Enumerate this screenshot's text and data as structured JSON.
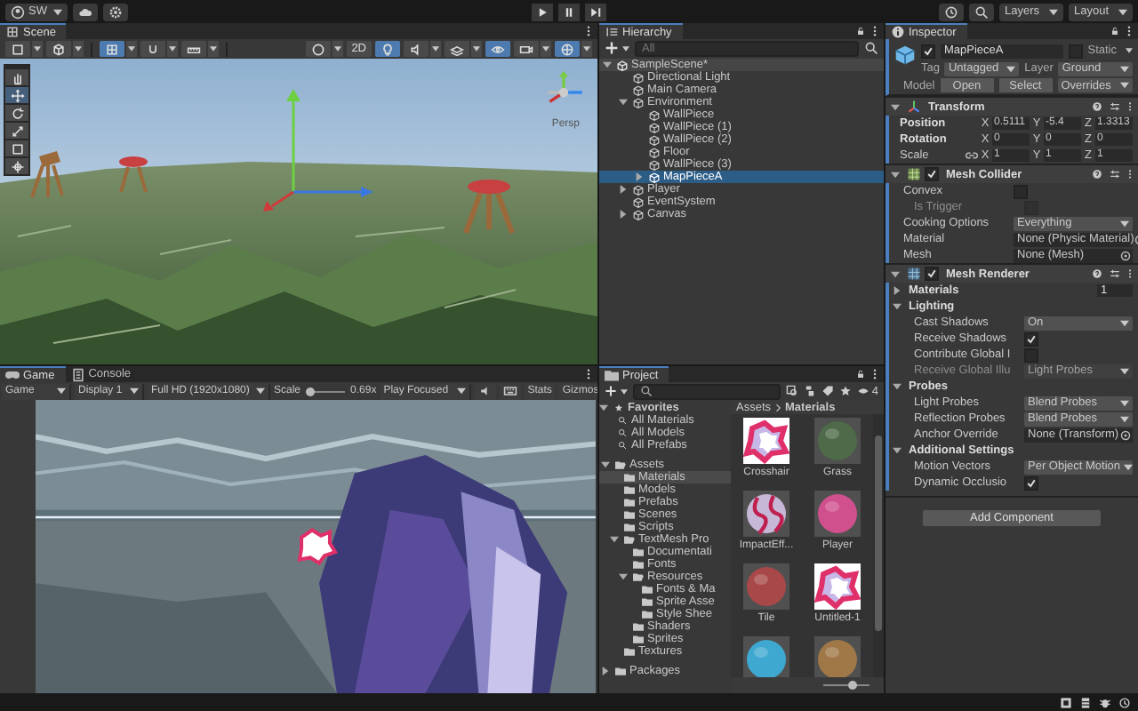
{
  "toolbar": {
    "account": "SW",
    "layers": "Layers",
    "layout": "Layout"
  },
  "scene": {
    "tab": "Scene",
    "toolbar": [
      {
        "kind": "shading",
        "selected": false
      },
      {
        "kind": "render",
        "selected": false
      },
      {
        "kind": "grid",
        "selected": true
      },
      {
        "kind": "snap",
        "selected": false
      },
      {
        "kind": "increment",
        "selected": false
      },
      {
        "kind": "orbit",
        "selected": false
      },
      {
        "kind": "dimension",
        "selected": false
      },
      {
        "kind": "light",
        "selected": true
      },
      {
        "kind": "audio",
        "selected": false
      },
      {
        "kind": "effects",
        "selected": false
      },
      {
        "kind": "visibility",
        "selected": true
      },
      {
        "kind": "camera",
        "selected": false
      },
      {
        "kind": "gizmos",
        "selected": true
      }
    ],
    "toggle_2d": "2D",
    "tools": [
      {
        "kind": "hand",
        "selected": false
      },
      {
        "kind": "move",
        "selected": true
      },
      {
        "kind": "rotate",
        "selected": false
      },
      {
        "kind": "scale",
        "selected": false
      },
      {
        "kind": "rect",
        "selected": false
      },
      {
        "kind": "transform",
        "selected": false
      }
    ],
    "view_label": "Persp"
  },
  "game": {
    "tabs": [
      {
        "label": "Game",
        "selected": true
      },
      {
        "label": "Console",
        "selected": false
      }
    ],
    "view_mode": "Game",
    "display": "Display 1",
    "resolution": "Full HD (1920x1080)",
    "scale_label": "Scale",
    "scale": {
      "level": 0.1
    },
    "scale_value": "0.69x",
    "play_mode": "Play Focused",
    "stats": "Stats",
    "gizmos": "Gizmos"
  },
  "hierarchy": {
    "title": "Hierarchy",
    "search_placeholder": "All",
    "tree": [
      {
        "name": "SampleScene*",
        "kind": "scene",
        "expanded": true,
        "selected": false,
        "children": [
          {
            "name": "Directional Light",
            "kind": "object",
            "selected": false
          },
          {
            "name": "Main Camera",
            "kind": "object",
            "selected": false
          },
          {
            "name": "Environment",
            "kind": "object",
            "expanded": true,
            "selected": false,
            "children": [
              {
                "name": "WallPiece",
                "kind": "object",
                "selected": false
              },
              {
                "name": "WallPiece (1)",
                "kind": "object",
                "selected": false
              },
              {
                "name": "WallPiece (2)",
                "kind": "object",
                "selected": false
              },
              {
                "name": "Floor",
                "kind": "object",
                "selected": false
              },
              {
                "name": "WallPiece (3)",
                "kind": "object",
                "selected": false
              },
              {
                "name": "MapPieceA",
                "kind": "object",
                "expanded": false,
                "selected": true
              }
            ]
          },
          {
            "name": "Player",
            "kind": "object",
            "expanded": false,
            "selected": false
          },
          {
            "name": "EventSystem",
            "kind": "object",
            "selected": false
          },
          {
            "name": "Canvas",
            "kind": "object",
            "expanded": false,
            "selected": false
          }
        ]
      }
    ]
  },
  "project": {
    "title": "Project",
    "item_count": "4",
    "favorites": {
      "label": "Favorites",
      "expanded": true,
      "items": [
        "All Materials",
        "All Models",
        "All Prefabs"
      ]
    },
    "assets_tree": [
      {
        "name": "Assets",
        "expanded": true,
        "selected": false,
        "children": [
          {
            "name": "Materials",
            "selected": true
          },
          {
            "name": "Models",
            "selected": false
          },
          {
            "name": "Prefabs",
            "selected": false
          },
          {
            "name": "Scenes",
            "selected": false
          },
          {
            "name": "Scripts",
            "selected": false
          },
          {
            "name": "TextMesh Pro",
            "expanded": true,
            "selected": false,
            "children": [
              {
                "name": "Documentati",
                "selected": false
              },
              {
                "name": "Fonts",
                "selected": false
              },
              {
                "name": "Resources",
                "expanded": true,
                "selected": false,
                "children": [
                  {
                    "name": "Fonts & Ma",
                    "selected": false
                  },
                  {
                    "name": "Sprite Asse",
                    "selected": false
                  },
                  {
                    "name": "Style Shee",
                    "selected": false
                  }
                ]
              },
              {
                "name": "Shaders",
                "selected": false
              },
              {
                "name": "Sprites",
                "selected": false
              }
            ]
          },
          {
            "name": "Textures",
            "selected": false
          }
        ]
      },
      {
        "name": "Packages",
        "expanded": false,
        "selected": false
      }
    ],
    "breadcrumb": [
      "Assets",
      "Materials"
    ],
    "assets": [
      {
        "name": "Crosshair",
        "kind": "image",
        "color": "#e0306a"
      },
      {
        "name": "Grass",
        "kind": "sphere",
        "color": "#4e6a48"
      },
      {
        "name": "ImpactEff...",
        "kind": "striped",
        "color": "#c8b8d8"
      },
      {
        "name": "Player",
        "kind": "sphere",
        "color": "#d0508e"
      },
      {
        "name": "Tile",
        "kind": "sphere",
        "color": "#a84848"
      },
      {
        "name": "Untitled-1",
        "kind": "image",
        "color": "#e0306a"
      },
      {
        "kind": "sphere",
        "color": "#3fa8d0"
      },
      {
        "kind": "sphere",
        "color": "#a07848"
      }
    ],
    "zoom": {
      "level": 0.6
    }
  },
  "inspector": {
    "title": "Inspector",
    "object": {
      "active": true,
      "name": "MapPieceA",
      "static_label": "Static",
      "static": false,
      "tag_label": "Tag",
      "tag": "Untagged",
      "layer_label": "Layer",
      "layer": "Ground",
      "model_label": "Model",
      "model_buttons": [
        "Open",
        "Select"
      ],
      "overrides": "Overrides"
    },
    "transform": {
      "title": "Transform",
      "expanded": true,
      "rows": [
        {
          "label": "Position",
          "linked": false,
          "fields": [
            {
              "axis": "X",
              "value": "0.5111"
            },
            {
              "axis": "Y",
              "value": "-5.4"
            },
            {
              "axis": "Z",
              "value": "1.3313"
            }
          ]
        },
        {
          "label": "Rotation",
          "linked": false,
          "fields": [
            {
              "axis": "X",
              "value": "0"
            },
            {
              "axis": "Y",
              "value": "0"
            },
            {
              "axis": "Z",
              "value": "0"
            }
          ]
        },
        {
          "label": "Scale",
          "linked": true,
          "fields": [
            {
              "axis": "X",
              "value": "1"
            },
            {
              "axis": "Y",
              "value": "1"
            },
            {
              "axis": "Z",
              "value": "1"
            }
          ]
        }
      ]
    },
    "components": [
      {
        "title": "Mesh Collider",
        "kind": "collider",
        "enabled": true,
        "expanded": true,
        "rows": [
          {
            "kind": "checkbox",
            "label": "Convex",
            "checked": false,
            "disabled": false,
            "children": [
              {
                "kind": "checkbox",
                "label": "Is Trigger",
                "checked": false,
                "disabled": true
              }
            ]
          },
          {
            "kind": "dropdown",
            "label": "Cooking Options",
            "value": "Everything",
            "disabled": false
          },
          {
            "kind": "object",
            "label": "Material",
            "value": "None (Physic Material)",
            "disabled": false
          },
          {
            "kind": "object",
            "label": "Mesh",
            "value": "None (Mesh)",
            "disabled": false
          }
        ]
      },
      {
        "title": "Mesh Renderer",
        "kind": "renderer",
        "enabled": true,
        "expanded": true,
        "rows": [
          {
            "kind": "section",
            "label": "Materials",
            "expanded": false,
            "value": "1"
          },
          {
            "kind": "section",
            "label": "Lighting",
            "expanded": true,
            "children": [
              {
                "kind": "dropdown",
                "label": "Cast Shadows",
                "value": "On",
                "disabled": false
              },
              {
                "kind": "checkbox",
                "label": "Receive Shadows",
                "checked": true,
                "disabled": false
              },
              {
                "kind": "checkbox",
                "label": "Contribute Global I",
                "checked": false,
                "disabled": false
              },
              {
                "kind": "dropdown",
                "label": "Receive Global Illu",
                "value": "Light Probes",
                "disabled": true
              }
            ]
          },
          {
            "kind": "section",
            "label": "Probes",
            "expanded": true,
            "children": [
              {
                "kind": "dropdown",
                "label": "Light Probes",
                "value": "Blend Probes",
                "disabled": false
              },
              {
                "kind": "dropdown",
                "label": "Reflection Probes",
                "value": "Blend Probes",
                "disabled": false
              },
              {
                "kind": "object",
                "label": "Anchor Override",
                "value": "None (Transform)",
                "disabled": false
              }
            ]
          },
          {
            "kind": "section",
            "label": "Additional Settings",
            "expanded": true,
            "children": [
              {
                "kind": "dropdown",
                "label": "Motion Vectors",
                "value": "Per Object Motion",
                "disabled": false
              },
              {
                "kind": "checkbox",
                "label": "Dynamic Occlusio",
                "checked": true,
                "disabled": false
              }
            ]
          }
        ]
      }
    ],
    "add_component": "Add Component"
  }
}
